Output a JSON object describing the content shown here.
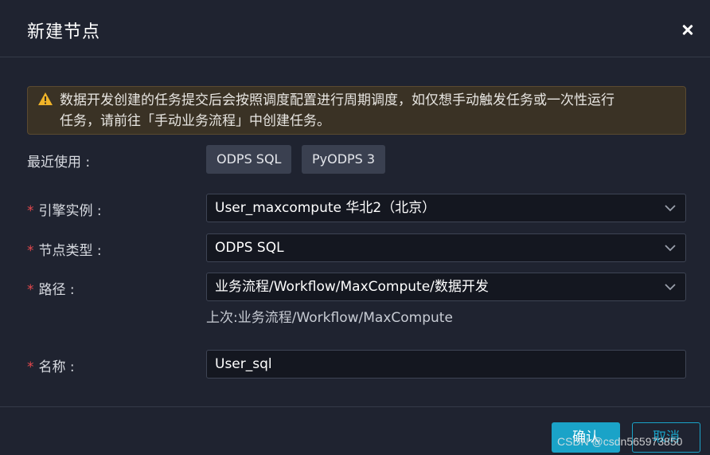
{
  "dialog": {
    "title": "新建节点",
    "close_icon": "close-icon"
  },
  "alert": {
    "icon": "warning-icon",
    "icon_color": "#f0b429",
    "line1": "数据开发创建的任务提交后会按照调度配置进行周期调度，如仅想手动触发任务或一次性运行",
    "line2": "任务，请前往「手动业务流程」中创建任务。"
  },
  "recent": {
    "label": "最近使用 :",
    "chips": [
      "ODPS SQL",
      "PyODPS 3"
    ]
  },
  "form": {
    "required_mark": "*",
    "engine": {
      "label": "引擎实例 :",
      "value": "User_maxcompute 华北2（北京）"
    },
    "node_type": {
      "label": "节点类型 :",
      "value": "ODPS SQL"
    },
    "path": {
      "label": "路径 :",
      "value": "业务流程/Workflow/MaxCompute/数据开发",
      "hint": "上次:业务流程/Workflow/MaxCompute"
    },
    "name": {
      "label": "名称 :",
      "value": "User_sql"
    }
  },
  "footer": {
    "ok_label": "确认",
    "cancel_label": "取消"
  },
  "watermark": "CSDN @csdn565973850",
  "colors": {
    "background": "#1f2330",
    "accent": "#1aa3c8",
    "required": "#e5484d",
    "alert_bg": "#3a3225"
  }
}
